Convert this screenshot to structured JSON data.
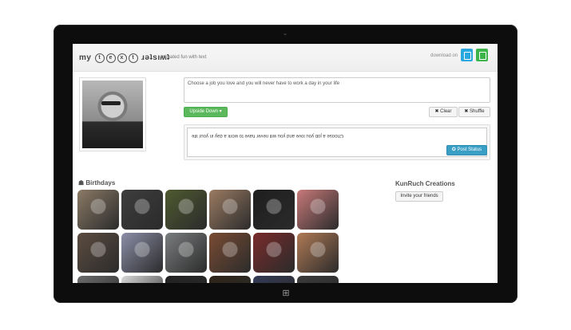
{
  "header": {
    "logo_prefix": "my",
    "logo_letters": [
      "t",
      "e",
      "x",
      "t"
    ],
    "logo_suffix": "ɹǝʇsıʍʇ",
    "tagline": "animated fun with text",
    "download_label": "download on"
  },
  "composer": {
    "input_text": "Choose a job you love and you will never have to work a day in your life",
    "mode_button": "Upside Down ▾",
    "clear_button": "✖ Clear",
    "shuffle_button": "✖ Shuffle",
    "output_text": "Choose a job you love and you will never have to work a day in your life",
    "post_button": "✪ Post Status"
  },
  "birthdays": {
    "title": "☗ Birthdays",
    "tiles": [
      {
        "color": "#8b7a66"
      },
      {
        "color": "#3d3d3d"
      },
      {
        "color": "#4f5a30"
      },
      {
        "color": "#9c7c63"
      },
      {
        "color": "#1e1e1e"
      },
      {
        "color": "#c87979"
      },
      {
        "color": "#5c4c40"
      },
      {
        "color": "#8c8fa8"
      },
      {
        "color": "#7a7d7e"
      },
      {
        "color": "#7a4c33"
      },
      {
        "color": "#7a2b2b"
      },
      {
        "color": "#b07a55"
      },
      {
        "color": "#6b6b6b"
      },
      {
        "color": "#d8d8d8"
      },
      {
        "color": "#222222"
      },
      {
        "color": "#2e2418"
      },
      {
        "color": "#333a55"
      },
      {
        "color": "#3a3a3a"
      }
    ]
  },
  "sidebar": {
    "title": "KunRuch Creations",
    "invite_button": "Invite your friends"
  },
  "colors": {
    "primary_green": "#5cb85c",
    "post_blue": "#3a9fc5",
    "store_blue": "#29a8e0",
    "store_green": "#3cb44a"
  }
}
